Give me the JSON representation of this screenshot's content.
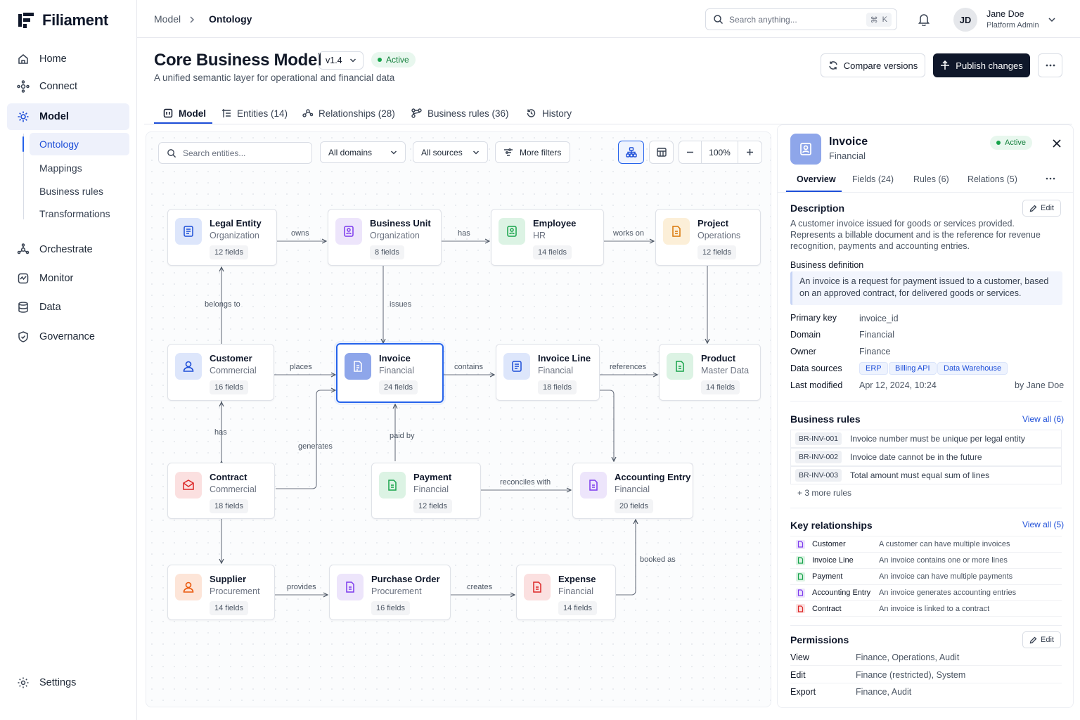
{
  "app": {
    "name": "Filiament"
  },
  "sidebar": {
    "items": [
      {
        "label": "Home",
        "icon": "home-icon"
      },
      {
        "label": "Connect",
        "icon": "connect-icon"
      },
      {
        "label": "Model",
        "icon": "model-icon"
      },
      {
        "label": "Orchestrate",
        "icon": "orchestrate-icon"
      },
      {
        "label": "Monitor",
        "icon": "monitor-icon"
      },
      {
        "label": "Data",
        "icon": "database-icon"
      },
      {
        "label": "Governance",
        "icon": "shield-icon"
      }
    ],
    "sub_items": [
      "Ontology",
      "Mappings",
      "Business rules",
      "Transformations"
    ],
    "settings": "Settings"
  },
  "topbar": {
    "breadcrumb": [
      "Model",
      "Ontology"
    ],
    "search_placeholder": "Search anything...",
    "shortcut_symbol": "⌘",
    "shortcut_key": "K",
    "user": {
      "initials": "JD",
      "name": "Jane Doe",
      "role": "Platform Admin"
    }
  },
  "header": {
    "title": "Core Business Model",
    "version": "v1.4",
    "status": "Active",
    "subtitle": "A unified semantic layer for operational and financial data",
    "compare_label": "Compare versions",
    "publish_label": "Publish changes"
  },
  "tabs": [
    {
      "label": "Model",
      "icon": "model-icon"
    },
    {
      "label": "Entities (14)",
      "icon": "entities-icon"
    },
    {
      "label": "Relationships (28)",
      "icon": "relationships-icon"
    },
    {
      "label": "Business rules (36)",
      "icon": "rules-icon"
    },
    {
      "label": "History",
      "icon": "history-icon"
    }
  ],
  "canvas_toolbar": {
    "search_placeholder": "Search entities...",
    "domain_filter": "All domains",
    "source_filter": "All sources",
    "more_filters": "More filters",
    "zoom": "100%"
  },
  "entities": {
    "legal_entity": {
      "name": "Legal Entity",
      "domain": "Organization",
      "fields": "12 fields"
    },
    "business_unit": {
      "name": "Business Unit",
      "domain": "Organization",
      "fields": "8 fields"
    },
    "employee": {
      "name": "Employee",
      "domain": "HR",
      "fields": "14 fields"
    },
    "project": {
      "name": "Project",
      "domain": "Operations",
      "fields": "12 fields"
    },
    "customer": {
      "name": "Customer",
      "domain": "Commercial",
      "fields": "16 fields"
    },
    "invoice": {
      "name": "Invoice",
      "domain": "Financial",
      "fields": "24 fields"
    },
    "invoice_line": {
      "name": "Invoice Line",
      "domain": "Financial",
      "fields": "18 fields"
    },
    "product": {
      "name": "Product",
      "domain": "Master Data",
      "fields": "14 fields"
    },
    "contract": {
      "name": "Contract",
      "domain": "Commercial",
      "fields": "18 fields"
    },
    "payment": {
      "name": "Payment",
      "domain": "Financial",
      "fields": "12 fields"
    },
    "accounting_entry": {
      "name": "Accounting Entry",
      "domain": "Financial",
      "fields": "20 fields"
    },
    "supplier": {
      "name": "Supplier",
      "domain": "Procurement",
      "fields": "14 fields"
    },
    "purchase_order": {
      "name": "Purchase Order",
      "domain": "Procurement",
      "fields": "16 fields"
    },
    "expense": {
      "name": "Expense",
      "domain": "Financial",
      "fields": "14 fields"
    }
  },
  "edges": {
    "owns": "owns",
    "has1": "has",
    "works_on": "works on",
    "belongs_to": "belongs to",
    "issues": "issues",
    "places": "places",
    "contains": "contains",
    "references": "references",
    "has2": "has",
    "generates": "generates",
    "paid_by": "paid by",
    "reconciles_with": "reconciles with",
    "booked_as": "booked as",
    "provides": "provides",
    "creates": "creates"
  },
  "panel": {
    "name": "Invoice",
    "domain": "Financial",
    "status": "Active",
    "tabs": [
      "Overview",
      "Fields (24)",
      "Rules (6)",
      "Relations (5)"
    ],
    "description_title": "Description",
    "edit_label": "Edit",
    "description": "A customer invoice issued for goods or services provided. Represents a billable document and is the reference for revenue recognition, payments and accounting entries.",
    "definition_title": "Business definition",
    "definition": "An invoice is a request for payment issued to a customer, based on an approved contract, for delivered goods or services.",
    "props": [
      {
        "key": "Primary key",
        "value": "invoice_id"
      },
      {
        "key": "Domain",
        "value": "Financial"
      },
      {
        "key": "Owner",
        "value": "Finance"
      },
      {
        "key": "Data sources",
        "value": ""
      },
      {
        "key": "Last modified",
        "value": "Apr 12, 2024, 10:24"
      }
    ],
    "sources": [
      "ERP",
      "Billing API",
      "Data Warehouse"
    ],
    "modified_by": "by Jane Doe",
    "rules_title": "Business rules",
    "rules_link": "View all (6)",
    "rules": [
      {
        "id": "BR-INV-001",
        "text": "Invoice number must be unique per legal entity"
      },
      {
        "id": "BR-INV-002",
        "text": "Invoice date cannot be in the future"
      },
      {
        "id": "BR-INV-003",
        "text": "Total amount must equal sum of lines"
      }
    ],
    "more_rules": "+ 3 more rules",
    "rel_title": "Key relationships",
    "rel_link": "View all (5)",
    "relationships": [
      {
        "entity": "Customer",
        "desc": "A customer can have multiple invoices",
        "color": "#7c3aed"
      },
      {
        "entity": "Invoice Line",
        "desc": "An invoice contains one or more lines",
        "color": "#16a34a"
      },
      {
        "entity": "Payment",
        "desc": "An invoice can have multiple payments",
        "color": "#16a34a"
      },
      {
        "entity": "Accounting Entry",
        "desc": "An invoice generates accounting entries",
        "color": "#7c3aed"
      },
      {
        "entity": "Contract",
        "desc": "An invoice is linked to a contract",
        "color": "#dc2626"
      }
    ],
    "perm_title": "Permissions",
    "permissions": [
      {
        "key": "View",
        "value": "Finance, Operations, Audit"
      },
      {
        "key": "Edit",
        "value": "Finance (restricted), System"
      },
      {
        "key": "Export",
        "value": "Finance, Audit"
      }
    ]
  },
  "colors": {
    "accent": "#2563eb",
    "dark": "#0f172a",
    "active_green": "#16a34a"
  }
}
